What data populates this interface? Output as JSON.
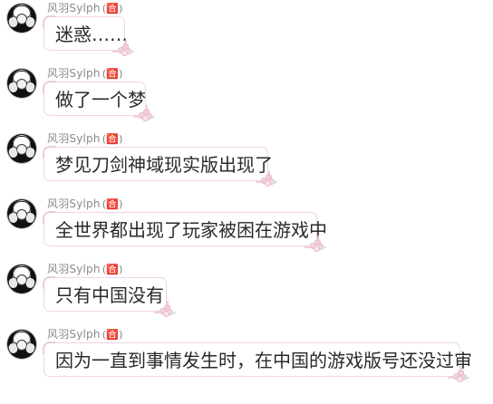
{
  "messages": [
    {
      "sender": "风羽Sylph",
      "badge": "(🈴)",
      "text": "迷惑……",
      "avatar": "angel-avatar",
      "bubble_width": 90
    },
    {
      "sender": "风羽Sylph",
      "badge": "(🈴)",
      "text": "做了一个梦",
      "avatar": "angel-avatar",
      "bubble_width": 113
    },
    {
      "sender": "风羽Sylph",
      "badge": "(🈴)",
      "text": "梦见刀剑神域现实版出现了",
      "avatar": "angel-avatar",
      "bubble_width": 248
    },
    {
      "sender": "风羽Sylph",
      "badge": "(🈴)",
      "text": "全世界都出现了玩家被困在游戏中",
      "avatar": "angel-avatar",
      "bubble_width": 302
    },
    {
      "sender": "风羽Sylph",
      "badge": "(🈴)",
      "text": "只有中国没有",
      "avatar": "angel-avatar",
      "bubble_width": 136
    },
    {
      "sender": "风羽Sylph",
      "badge": "(🈴)",
      "text": "因为一直到事情发生时，在中国的游戏版号还没过审",
      "avatar": "angel-avatar",
      "bubble_width": 460
    }
  ]
}
